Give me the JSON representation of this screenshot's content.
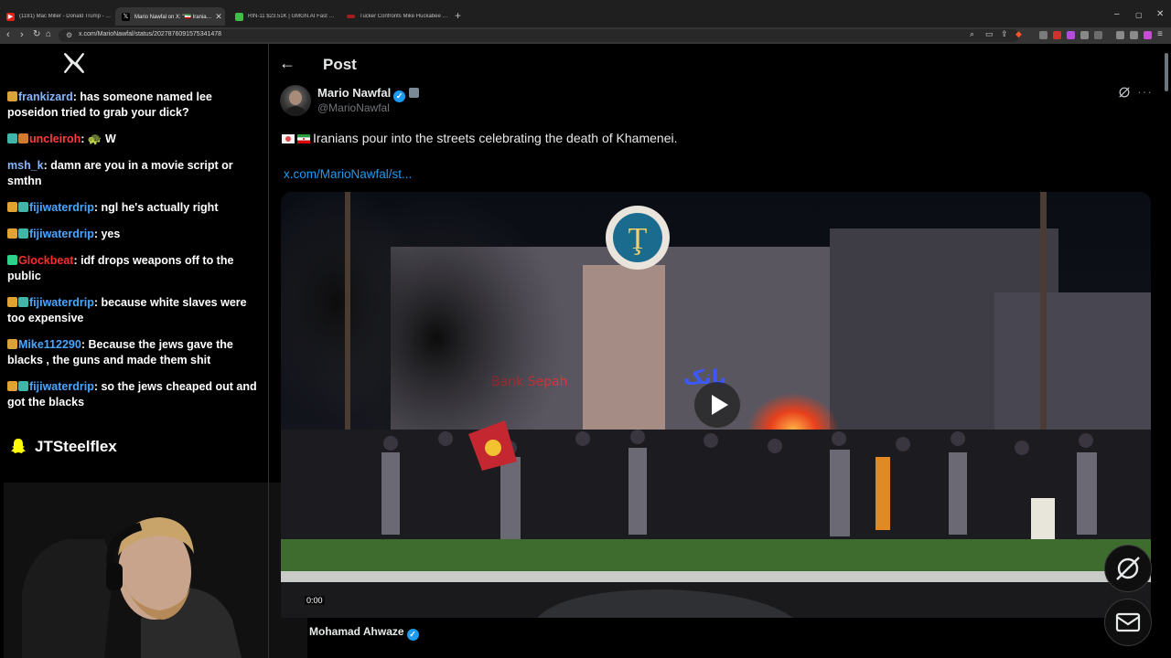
{
  "browser": {
    "tabs": [
      {
        "label": "(1181) Mac Miller - Donald Trump - Y..."
      },
      {
        "label": "Mario Nawfal on X: \"🇮🇷 Iranians..."
      },
      {
        "label": "RIN-11 $23.51K | GMGN.AI Fast Trad..."
      },
      {
        "label": "Tucker Confronts Mike Huckabee on..."
      }
    ],
    "new_tab": "+",
    "url": "x.com/MarioNawfal/status/2027876091575341478",
    "window": {
      "minimize": "–",
      "maximize": "▢",
      "close": "✕"
    }
  },
  "chat": {
    "messages": [
      {
        "user": "frankizard",
        "text": ": has someone named lee poseidon tried to grab your dick?"
      },
      {
        "user": "uncleiroh",
        "text": ": 🐢 W"
      },
      {
        "user": "msh_k",
        "text": ": damn are you in a movie script or smthn"
      },
      {
        "user": "fijiwaterdrip",
        "text": ": ngl he's actually right"
      },
      {
        "user": "fijiwaterdrip",
        "text": ": yes"
      },
      {
        "user": "Glockbeat",
        "text": ": idf drops weapons off to the public"
      },
      {
        "user": "fijiwaterdrip",
        "text": ": because white slaves were too expensive"
      },
      {
        "user": "Mike112290",
        "text": ": Because the jews gave the blacks , the guns and made them shit"
      },
      {
        "user": "fijiwaterdrip",
        "text": ": so the jews cheaped out and got the blacks"
      }
    ],
    "snapchat_handle": "JTSteelflex"
  },
  "post": {
    "heading": "Post",
    "author": {
      "name": "Mario Nawfal",
      "handle": "@MarioNawfal"
    },
    "text": "Iranians pour into the streets celebrating the death of Khamenei.",
    "link": "x.com/MarioNawfal/st...",
    "video": {
      "time": "0:00",
      "quoted_author": "Mohamad Ahwaze"
    }
  },
  "colors": {
    "accent": "#1d9bf0",
    "background": "#000000",
    "text": "#e7e9ea",
    "muted": "#71767b"
  }
}
